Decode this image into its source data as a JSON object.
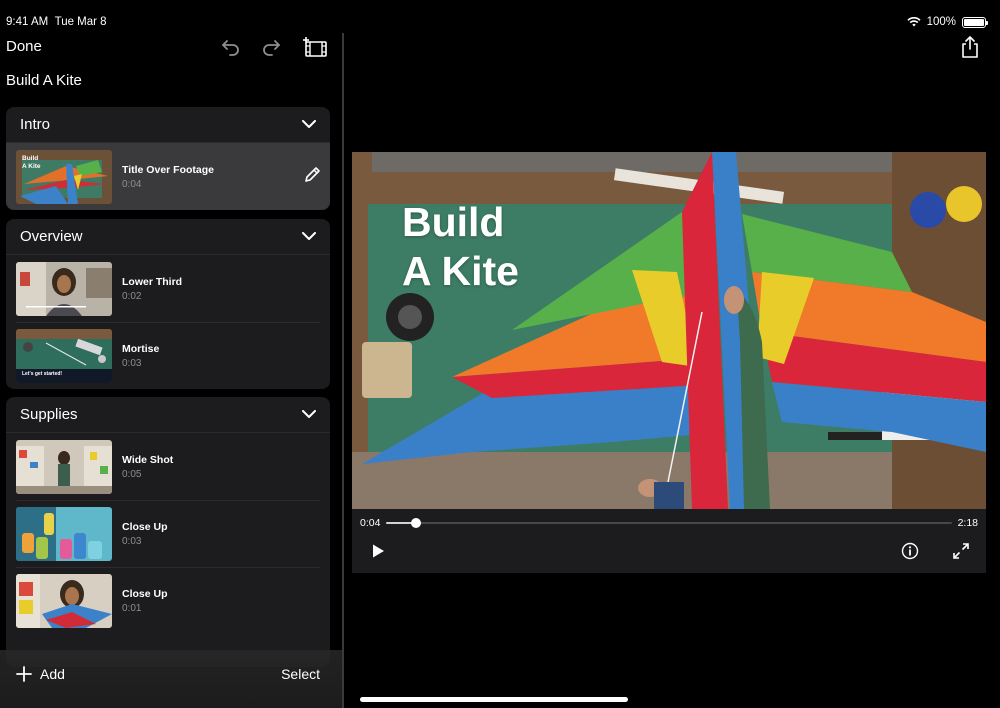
{
  "status": {
    "time": "9:41 AM",
    "date": "Tue Mar 8",
    "battery": "100%"
  },
  "toolbar": {
    "done_label": "Done",
    "icons": [
      "undo-icon",
      "redo-icon",
      "clip-library-icon",
      "share-icon"
    ]
  },
  "project": {
    "title": "Build A Kite"
  },
  "sections": [
    {
      "title": "Intro",
      "clips": [
        {
          "title": "Title Over Footage",
          "duration": "0:04",
          "selected": true,
          "overlay": "Build\nA Kite"
        }
      ]
    },
    {
      "title": "Overview",
      "clips": [
        {
          "title": "Lower Third",
          "duration": "0:02"
        },
        {
          "title": "Mortise",
          "duration": "0:03",
          "overlay": "Let's get started!"
        }
      ]
    },
    {
      "title": "Supplies",
      "clips": [
        {
          "title": "Wide Shot",
          "duration": "0:05"
        },
        {
          "title": "Close Up",
          "duration": "0:03"
        },
        {
          "title": "Close Up",
          "duration": "0:01"
        }
      ]
    }
  ],
  "bottom": {
    "add_label": "Add",
    "select_label": "Select"
  },
  "viewer": {
    "title_overlay": "Build\nA Kite"
  },
  "playback": {
    "current": "0:04",
    "total": "2:18",
    "progress": 0.0531
  },
  "colors": {
    "background": "#000000",
    "panel": "#1c1c1e",
    "selected": "#3a3a3c",
    "secondary_text": "#8e8e93"
  }
}
